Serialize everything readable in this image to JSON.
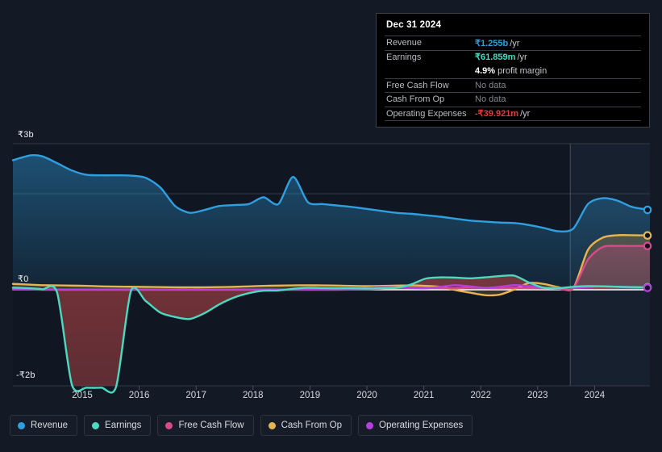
{
  "tooltip": {
    "date": "Dec 31 2024",
    "rows": [
      {
        "label": "Revenue",
        "value": "₹1.255b",
        "unit": "/yr",
        "style": "blue"
      },
      {
        "label": "Earnings",
        "value": "₹61.859m",
        "unit": "/yr",
        "style": "teal"
      },
      {
        "label": "",
        "value": "4.9%",
        "unit": "profit margin",
        "style": "margin"
      },
      {
        "label": "Free Cash Flow",
        "value": "No data",
        "unit": "",
        "style": "muted"
      },
      {
        "label": "Cash From Op",
        "value": "No data",
        "unit": "",
        "style": "muted"
      },
      {
        "label": "Operating Expenses",
        "value": "-₹39.921m",
        "unit": "/yr",
        "style": "red"
      }
    ]
  },
  "legend": {
    "items": [
      {
        "label": "Revenue",
        "color": "#2f9fe0"
      },
      {
        "label": "Earnings",
        "color": "#4cd9c0"
      },
      {
        "label": "Free Cash Flow",
        "color": "#d94a8c"
      },
      {
        "label": "Cash From Op",
        "color": "#e8b351"
      },
      {
        "label": "Operating Expenses",
        "color": "#b93ee0"
      }
    ]
  },
  "chart_data": {
    "type": "area",
    "title": "",
    "xlabel": "",
    "ylabel": "",
    "currency": "₹",
    "grid": true,
    "legend_position": "bottom",
    "ylim": [
      -2000000000,
      3000000000
    ],
    "y_ticks": [
      {
        "label": "₹3b",
        "value": 3000000000
      },
      {
        "label": "₹0",
        "value": 0
      },
      {
        "label": "-₹2b",
        "value": -2000000000
      }
    ],
    "x_ticks": [
      "2015",
      "2016",
      "2017",
      "2018",
      "2019",
      "2020",
      "2021",
      "2022",
      "2023",
      "2024"
    ],
    "forecast_start": "2024",
    "x": [
      2014.5,
      2014.8,
      2015.0,
      2015.25,
      2015.5,
      2015.75,
      2016.0,
      2016.25,
      2016.5,
      2016.75,
      2017.0,
      2017.25,
      2017.5,
      2017.75,
      2018.0,
      2018.25,
      2018.5,
      2018.75,
      2019.0,
      2019.25,
      2019.5,
      2019.75,
      2020.0,
      2020.25,
      2020.5,
      2020.75,
      2021.0,
      2021.25,
      2021.5,
      2021.75,
      2022.0,
      2022.25,
      2022.5,
      2022.75,
      2023.0,
      2023.25,
      2023.5,
      2023.75,
      2024.0,
      2024.25,
      2024.5,
      2024.75,
      2025.0,
      2025.3
    ],
    "series": [
      {
        "name": "Revenue",
        "color": "#2f9fe0",
        "fill": "rgba(35,110,170,0.45)",
        "values": [
          2660,
          2760,
          2740,
          2600,
          2450,
          2360,
          2350,
          2350,
          2345,
          2300,
          2100,
          1720,
          1580,
          1640,
          1720,
          1740,
          1760,
          1900,
          1760,
          2320,
          1800,
          1760,
          1730,
          1700,
          1660,
          1620,
          1580,
          1560,
          1530,
          1500,
          1460,
          1420,
          1400,
          1380,
          1370,
          1330,
          1270,
          1200,
          1255,
          1760,
          1880,
          1830,
          1700,
          1640
        ]
      },
      {
        "name": "Earnings",
        "color": "#4cd9c0",
        "fill": "rgba(140,60,60,0.55)",
        "values": [
          45,
          30,
          10,
          -60,
          -1950,
          -2010,
          -2010,
          -1990,
          -30,
          -230,
          -470,
          -560,
          -600,
          -480,
          -300,
          -160,
          -70,
          -20,
          -15,
          20,
          40,
          35,
          30,
          30,
          25,
          30,
          40,
          110,
          230,
          255,
          250,
          235,
          255,
          280,
          290,
          150,
          40,
          30,
          62,
          75,
          70,
          62,
          55,
          50
        ]
      },
      {
        "name": "Free Cash Flow",
        "color": "#d94a8c",
        "fill": "rgba(150,60,110,0.38)",
        "values": [
          10,
          5,
          0,
          0,
          0,
          0,
          0,
          0,
          0,
          0,
          0,
          0,
          0,
          0,
          0,
          0,
          0,
          0,
          0,
          0,
          0,
          0,
          0,
          5,
          10,
          25,
          40,
          45,
          40,
          35,
          30,
          45,
          35,
          30,
          40,
          35,
          30,
          20,
          30,
          620,
          880,
          900,
          900,
          900
        ]
      },
      {
        "name": "Cash From Op",
        "color": "#e8b351",
        "fill": "rgba(160,120,60,0.30)",
        "values": [
          120,
          105,
          95,
          90,
          85,
          80,
          70,
          65,
          62,
          58,
          55,
          50,
          50,
          50,
          55,
          60,
          70,
          80,
          85,
          90,
          92,
          90,
          85,
          80,
          75,
          80,
          85,
          90,
          80,
          60,
          -5,
          -60,
          -110,
          -100,
          5,
          140,
          120,
          55,
          30,
          820,
          1070,
          1120,
          1120,
          1115
        ]
      },
      {
        "name": "Operating Expenses",
        "color": "#b93ee0",
        "fill": "none",
        "values": [
          5,
          5,
          5,
          5,
          5,
          5,
          5,
          5,
          5,
          5,
          5,
          5,
          5,
          5,
          5,
          5,
          5,
          5,
          5,
          5,
          5,
          8,
          10,
          15,
          40,
          55,
          50,
          35,
          30,
          60,
          95,
          70,
          40,
          60,
          95,
          75,
          45,
          40,
          40,
          55,
          75,
          60,
          40,
          40
        ]
      }
    ],
    "units_note": "values in millions of ₹"
  }
}
